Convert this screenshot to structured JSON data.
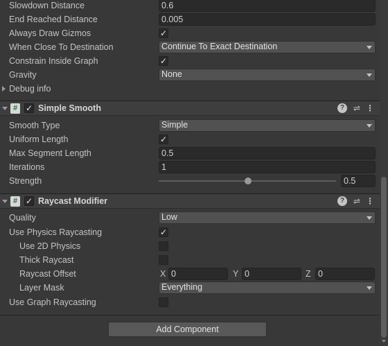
{
  "ai_path_section": {
    "slowdown_distance": {
      "label": "Slowdown Distance",
      "value": "0.6"
    },
    "end_reached_distance": {
      "label": "End Reached Distance",
      "value": "0.005"
    },
    "always_draw_gizmos": {
      "label": "Always Draw Gizmos",
      "checked": true
    },
    "when_close": {
      "label": "When Close To Destination",
      "value": "Continue To Exact Destination"
    },
    "constrain_inside_graph": {
      "label": "Constrain Inside Graph",
      "checked": true
    },
    "gravity": {
      "label": "Gravity",
      "value": "None"
    },
    "debug_info": {
      "label": "Debug info"
    }
  },
  "simple_smooth": {
    "title": "Simple Smooth",
    "enabled": true,
    "smooth_type": {
      "label": "Smooth Type",
      "value": "Simple"
    },
    "uniform_length": {
      "label": "Uniform Length",
      "checked": true
    },
    "max_segment_length": {
      "label": "Max Segment Length",
      "value": "0.5"
    },
    "iterations": {
      "label": "Iterations",
      "value": "1"
    },
    "strength": {
      "label": "Strength",
      "value": "0.5",
      "fraction": 0.5
    }
  },
  "raycast_modifier": {
    "title": "Raycast Modifier",
    "enabled": true,
    "quality": {
      "label": "Quality",
      "value": "Low"
    },
    "use_physics_raycasting": {
      "label": "Use Physics Raycasting",
      "checked": true
    },
    "use_2d_physics": {
      "label": "Use 2D Physics",
      "checked": false
    },
    "thick_raycast": {
      "label": "Thick Raycast",
      "checked": false
    },
    "raycast_offset": {
      "label": "Raycast Offset",
      "x_label": "X",
      "x": "0",
      "y_label": "Y",
      "y": "0",
      "z_label": "Z",
      "z": "0"
    },
    "layer_mask": {
      "label": "Layer Mask",
      "value": "Everything"
    },
    "use_graph_raycasting": {
      "label": "Use Graph Raycasting",
      "checked": false
    }
  },
  "header_icons": {
    "script": "#",
    "check": "✓",
    "help": "?",
    "preset": "⇌",
    "menu": "⋮"
  },
  "add_component_label": "Add Component"
}
